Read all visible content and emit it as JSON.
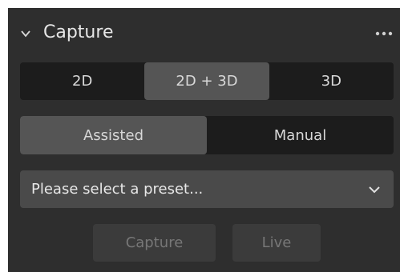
{
  "panel": {
    "title": "Capture",
    "expanded": true,
    "icons": {
      "collapse": "chevron-down-icon",
      "menu": "more-horizontal-icon"
    }
  },
  "mode": {
    "options": [
      "2D",
      "2D + 3D",
      "3D"
    ],
    "selected": "2D + 3D"
  },
  "assist": {
    "options": [
      "Assisted",
      "Manual"
    ],
    "selected": "Assisted"
  },
  "preset": {
    "placeholder": "Please select a preset..."
  },
  "actions": {
    "capture_label": "Capture",
    "live_label": "Live",
    "enabled": false
  },
  "colors": {
    "panel_bg": "#2e2e2e",
    "segment_bg": "#1c1c1c",
    "segment_active": "#555555",
    "text": "#e6e6e6",
    "disabled_text": "#777777"
  }
}
